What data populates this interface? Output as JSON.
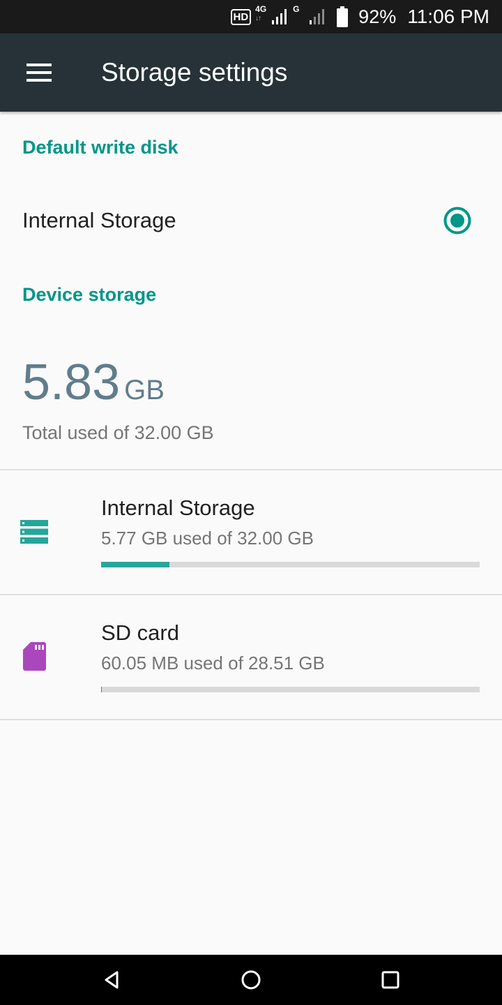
{
  "status_bar": {
    "hd": "HD",
    "network_1": "4G",
    "network_2": "G",
    "battery_percent": "92%",
    "time": "11:06 PM",
    "icons": [
      "hd-icon",
      "signal-icon",
      "signal-icon",
      "battery-icon"
    ]
  },
  "app_bar": {
    "title": "Storage settings",
    "menu_icon": "menu-icon"
  },
  "default_write_disk": {
    "header": "Default write disk",
    "option_label": "Internal Storage",
    "selected": true
  },
  "device_storage": {
    "header": "Device storage",
    "used_value": "5.83",
    "used_unit": "GB",
    "caption": "Total used of 32.00 GB"
  },
  "volumes": [
    {
      "title": "Internal Storage",
      "subtitle": "5.77 GB used of 32.00 GB",
      "icon": "storage-icon",
      "progress": 0.18,
      "color": "#26a69a"
    },
    {
      "title": "SD card",
      "subtitle": "60.05 MB used of 28.51 GB",
      "icon": "sd-card-icon",
      "progress": 0.002,
      "color": "#ab47bc"
    }
  ],
  "nav_bar": {
    "icons": [
      "back-icon",
      "home-icon",
      "recents-icon"
    ]
  },
  "colors": {
    "accent": "#009688",
    "app_bar": "#263238",
    "status_bar": "#1a1a1a",
    "summary_text": "#607d8b",
    "sd_card": "#ab47bc"
  }
}
